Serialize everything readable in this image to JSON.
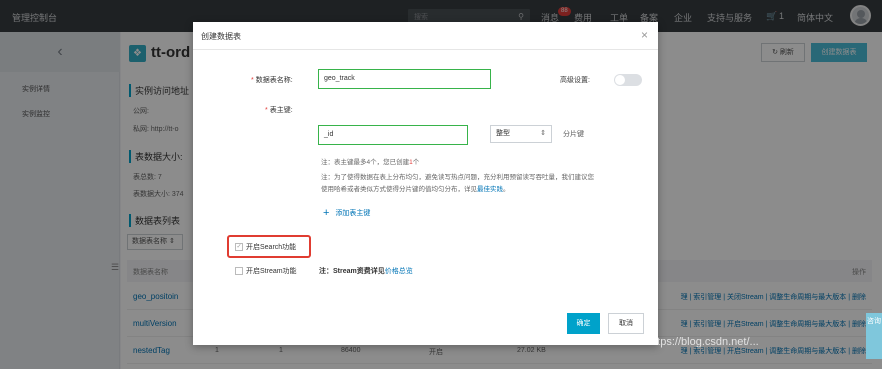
{
  "topbar": {
    "brand": "管理控制台",
    "search_placeholder": "搜索",
    "nav": [
      "消息",
      "费用",
      "工单",
      "备案",
      "企业",
      "支持与服务",
      "1",
      "简体中文"
    ],
    "message_badge": "88"
  },
  "sidebar": {
    "items": [
      "实例详情",
      "实例监控"
    ]
  },
  "main": {
    "title": "tt-ord",
    "refresh_label": "刷新",
    "create_table_label": "创建数据表",
    "sections": {
      "access": "实例访问地址",
      "size": "表数据大小:",
      "list": "数据表列表"
    },
    "access_rows": [
      "公网:",
      "私网:  http://tt-o"
    ],
    "size_rows": [
      "表总数: 7",
      "表数据大小: 374"
    ],
    "filter_label": "数据表名称",
    "table_header": {
      "name": "数据表名称",
      "ops": "操作"
    },
    "rows": [
      {
        "name": "geo_positoin",
        "ops": "理 | 索引管理 | 关闭Stream | 调整生命周期与最大版本 | 删除"
      },
      {
        "name": "multiVersion",
        "ops": "理 | 索引管理 | 开启Stream | 调整生命周期与最大版本 | 删除"
      },
      {
        "name": "nestedTag",
        "ops": "理 | 索引管理 | 开启Stream | 调整生命周期与最大版本 | 删除"
      }
    ],
    "row3_extra": [
      "1",
      "1",
      "86400",
      "开启",
      "27.02 KB"
    ]
  },
  "modal": {
    "title": "创建数据表",
    "table_name_label": "数据表名称:",
    "table_name_value": "geo_track",
    "advanced_label": "高级设置:",
    "pk_label": "表主键:",
    "pk_value": "_id",
    "pk_type": "整型",
    "partition_key_label": "分片键",
    "note1_prefix": "注：表主键最多4个，您已创建",
    "note1_count": "1",
    "note1_suffix": "个",
    "note2_line1": "注：为了使得数据在表上分布均匀，避免读写热点问题，充分利用预留读写吞吐量，我们建议您",
    "note2_line2_prefix": "使用哈希或者类似方式使得分片键的值均匀分布，详见",
    "note2_link": "最佳实践",
    "note2_end": "。",
    "add_pk_label": "添加表主键",
    "search_label": "开启Search功能",
    "stream_label": "开启Stream功能",
    "stream_note_prefix": "注：Stream资费详见",
    "stream_note_link": "价格总览",
    "ok_label": "确定",
    "cancel_label": "取消"
  },
  "edge_widget": "咨询",
  "watermark": "https://blog.csdn.net/...",
  "colors": {
    "accent": "#00a2ca",
    "highlight_box": "#e03c31",
    "input_border": "#37b34a"
  }
}
